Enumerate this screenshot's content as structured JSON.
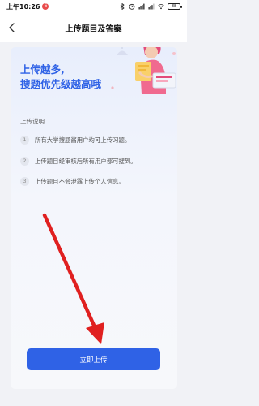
{
  "status_bar": {
    "time": "上午10:26",
    "badge": "6",
    "battery": "88"
  },
  "header": {
    "title": "上传题目及答案"
  },
  "card": {
    "headline": [
      "上传越多,",
      "搜题优先级越高哦"
    ],
    "section_label": "上传说明",
    "steps": [
      {
        "num": "1",
        "text": "所有大学搜题酱用户均可上传习题。"
      },
      {
        "num": "2",
        "text": "上传题目经审核后所有用户都可搜到。"
      },
      {
        "num": "3",
        "text": "上传题目不会泄露上传个人信息。"
      }
    ]
  },
  "upload_button": {
    "label": "立即上传"
  },
  "colors": {
    "accent": "#2f62e6",
    "annotation_arrow": "#e02020"
  }
}
